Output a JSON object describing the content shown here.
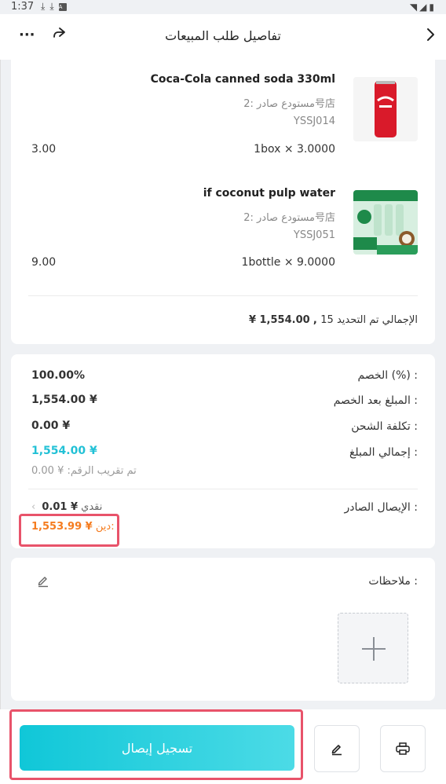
{
  "status_bar": {
    "time": "1:37",
    "icons": [
      "download-icon",
      "download-icon",
      "app-icon",
      "wifi-icon",
      "signal-icon",
      "battery-icon"
    ]
  },
  "header": {
    "title": "تفاصيل طلب المبيعات"
  },
  "items": [
    {
      "name": "Coca-Cola canned soda 330ml",
      "store": "مستودع صادر  :2号店",
      "code": "YSSJ014",
      "qty": "1box ×  3.0000",
      "subtotal": "3.00"
    },
    {
      "name": "if coconut pulp water",
      "store": "مستودع صادر  :2号店",
      "code": "YSSJ051",
      "qty": "1bottle ×  9.0000",
      "subtotal": "9.00"
    }
  ],
  "summary": {
    "label": "الإجمالي تم التحديد",
    "count": "15",
    "sep": " ,",
    "amount": "1,554.00 ¥"
  },
  "totals": {
    "discount_label": "الخصم (%) :",
    "discount_value": "100.00%",
    "after_discount_label": "المبلغ بعد الخصم :",
    "after_discount_value": "1,554.00 ¥",
    "shipping_label": "تكلفة الشحن :",
    "shipping_value": "0.00 ¥",
    "total_label": "إجمالي المبلغ :",
    "total_value": "1,554.00 ¥",
    "rounding_note": "تم تقريب الرقم: ¥ 0.00"
  },
  "receipt": {
    "label": "الإيصال الصادر :",
    "method": "نقدي",
    "cash_amount": "¥ 0.01",
    "debt_label": "دين:",
    "debt_amount": "1,553.99 ¥"
  },
  "notes": {
    "label": "ملاحظات :"
  },
  "bottom": {
    "submit_label": "تسجيل إيصال"
  },
  "colors": {
    "accent": "#22c1d6",
    "orange": "#f57c1f",
    "highlight": "#e8536a"
  }
}
